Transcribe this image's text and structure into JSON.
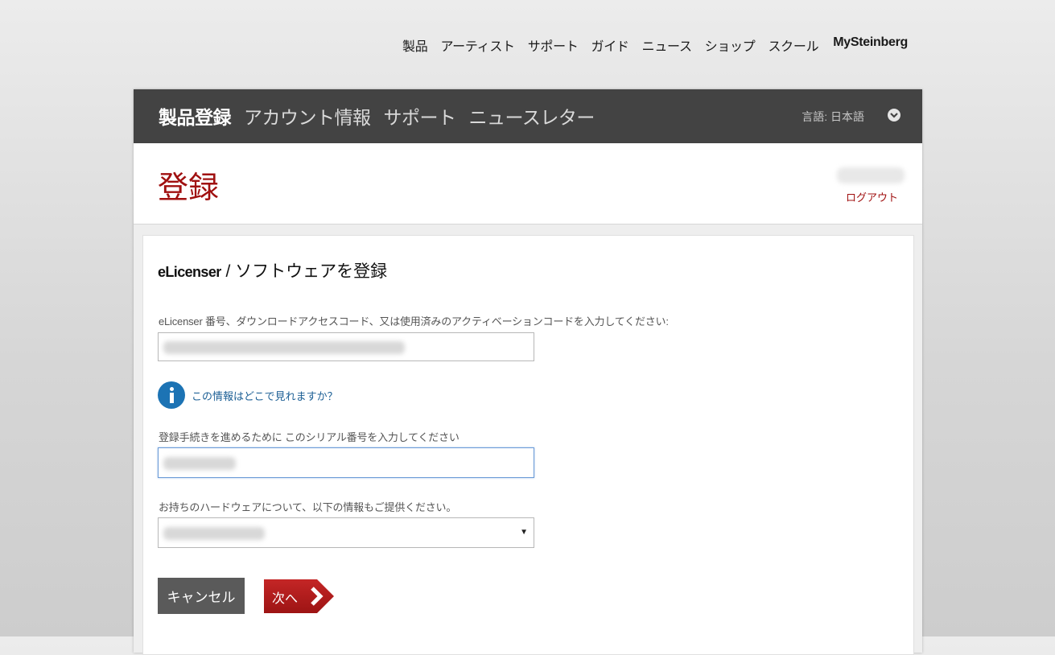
{
  "top_nav": {
    "items": [
      "製品",
      "アーティスト",
      "サポート",
      "ガイド",
      "ニュース",
      "ショップ",
      "スクール"
    ],
    "mysteinberg": "MySteinberg"
  },
  "account_menu": {
    "items": [
      "製品登録",
      "アカウント情報",
      "サポート",
      "ニュースレター"
    ],
    "active_index": 0,
    "language": "言語: 日本語"
  },
  "header": {
    "title": "登録",
    "logout": "ログアウト"
  },
  "form": {
    "heading_prefix": "eLicenser",
    "heading_rest": " / ソフトウェアを登録",
    "code_label": "eLicenser 番号、ダウンロードアクセスコード、又は使用済みのアクティベーションコードを入力してください:",
    "info_link": "この情報はどこで見れますか？",
    "serial_label": "登録手続きを進めるために このシリアル番号を入力してください",
    "hardware_label": "お持ちのハードウェアについて、以下の情報もご提供ください。",
    "cancel_label": "キャンセル",
    "next_label": "次へ"
  },
  "colors": {
    "accent_red": "#a01010",
    "dark_bar": "#434343",
    "info_blue": "#1c73b4",
    "next_button": "#b31d1d",
    "cancel_button": "#5a5a5a"
  }
}
